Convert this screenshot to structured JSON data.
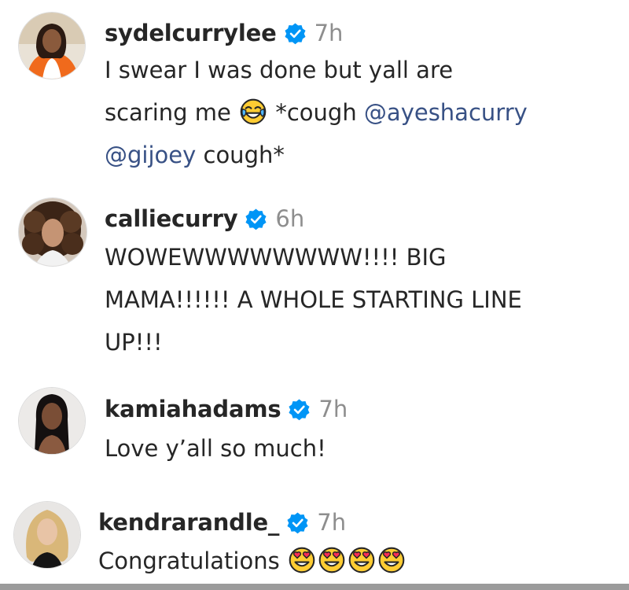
{
  "comments": [
    {
      "username": "sydelcurrylee",
      "time": "7h",
      "lines": [
        {
          "text1": "I swear I was done but yall are"
        },
        {
          "text1": "scaring me ",
          "emoji": "face-with-tears-of-joy",
          "text2": " *cough ",
          "mention1": "@ayeshacurry"
        },
        {
          "mention2": "@gijoey",
          "text3": " cough*"
        }
      ]
    },
    {
      "username": "calliecurry",
      "time": "6h",
      "lines": [
        {
          "text1": "WOWEWWWWWWWW!!!! BIG"
        },
        {
          "text1": "MAMA!!!!!! A WHOLE STARTING LINE"
        },
        {
          "text1": "UP!!!"
        }
      ]
    },
    {
      "username": "kamiahadams",
      "time": "7h",
      "lines": [
        {
          "text1": "Love y’all so much!"
        }
      ]
    },
    {
      "username": "kendrarandle_",
      "time": "7h",
      "lines": [
        {
          "text1": "Congratulations ",
          "emojis": [
            "smiling-face-with-heart-eyes",
            "smiling-face-with-heart-eyes",
            "smiling-face-with-heart-eyes",
            "smiling-face-with-heart-eyes"
          ]
        }
      ]
    }
  ],
  "icons": {
    "verified": "verified-badge-icon",
    "avatar": "profile-photo"
  },
  "colors": {
    "verified_blue": "#0095f6",
    "mention": "#385185",
    "timestamp": "#8e8e8e",
    "text": "#262626"
  }
}
